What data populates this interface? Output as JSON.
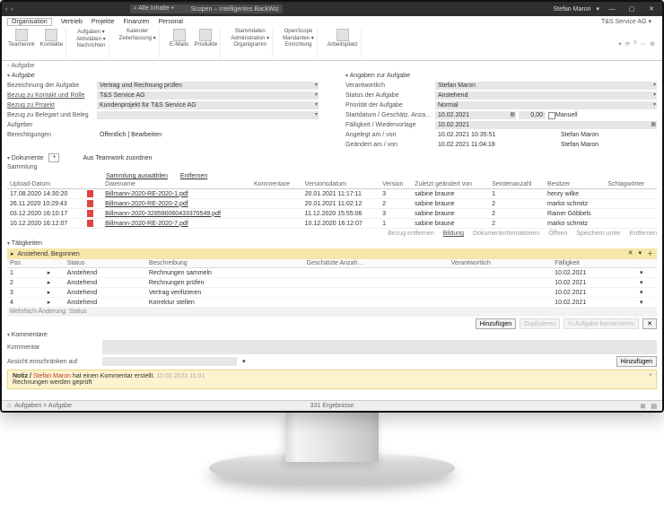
{
  "title": {
    "user": "Stefan Maron",
    "app": "Scopen – Intelligentes BackWiz",
    "search_scope": "Alle Inhalte"
  },
  "company": "T&S Service AG",
  "menu": [
    "Organisation",
    "Vertrieb",
    "Projekte",
    "Finanzen",
    "Personal"
  ],
  "ribbon": {
    "big": [
      {
        "name": "teamwork",
        "label": "Teamwork"
      },
      {
        "name": "kontakte",
        "label": "Kontakte"
      }
    ],
    "sub1": [
      "Aufgaben ▾",
      "Aktivitäten ▾",
      "Nachrichten"
    ],
    "sub2": [
      "Kalender",
      "Zeiterfassung ▾"
    ],
    "big2": [
      {
        "name": "emails",
        "label": "E-Mails"
      },
      {
        "name": "produkte",
        "label": "Produkte"
      }
    ],
    "sub3": [
      "Stammdaten",
      "Administration ▾",
      "Organigramm"
    ],
    "sub4": [
      "OpenScope",
      "Mandanten ▾",
      "Einrichtung"
    ],
    "arbeitsplatz": "Arbeitsplatz"
  },
  "crumb": "Aufgabe",
  "left": {
    "section": "Aufgabe",
    "rows": [
      {
        "label": "Bezeichnung der Aufgabe",
        "value": "Vertrag und Rechnung prüfen",
        "dd": true
      },
      {
        "label": "Bezug zu Kontakt und Rolle",
        "value": "T&S Service AG",
        "dd": true,
        "u": true
      },
      {
        "label": "Bezug zu Projekt",
        "value": "Kundenprojekt für T&S Service AG",
        "dd": true,
        "u": true
      },
      {
        "label": "Bezug zu Belegart und Beleg",
        "value": "",
        "dd": true
      },
      {
        "label": "Aufgeber",
        "value": "",
        "plain": true
      },
      {
        "label": "Berechtigungen",
        "value": "Öffentlich | Bearbeiten",
        "plain": true
      }
    ]
  },
  "right": {
    "section": "Angaben zur Aufgabe",
    "rows": [
      {
        "label": "Verantwortlich",
        "value": "Stefan Maron",
        "dd": true
      },
      {
        "label": "Status der Aufgabe",
        "value": "Anstehend",
        "dd": true
      },
      {
        "label": "Priorität der Aufgabe",
        "value": "Normal",
        "dd": true
      },
      {
        "label": "Startdatum / Geschätz. Anza…",
        "value": "10.02.2021",
        "cal": true,
        "extra_num": "0,00",
        "extra_label": "Manuell",
        "extra_chk": true
      },
      {
        "label": "Fälligkeit / Wiedervorlage",
        "value": "10.02.2021",
        "cal": true
      },
      {
        "label": "Angelegt am / von",
        "value": "10.02.2021 10:35:51",
        "person": "Stefan Maron"
      },
      {
        "label": "Geändert am / von",
        "value": "10.02.2021 11:04:18",
        "person": "Stefan Maron"
      }
    ]
  },
  "docs": {
    "section": "Dokumente",
    "assign": "Aus Teamwork zuordnen",
    "collection_label": "Sammlung",
    "tools": [
      "Sammlung auswählen",
      "Entfernen"
    ],
    "cols": [
      "Upload-Datum",
      "",
      "Dateiname",
      "Kommentare",
      "Versionsdatum",
      "Version",
      "Zuletzt geändert von",
      "Seintenanzahl",
      "Besitzer",
      "Schlagwörter"
    ],
    "rows": [
      {
        "date": "17.08.2020 14:30:20",
        "file": "Billmann-2020-RE-2020-1.pdf",
        "vdate": "20.01.2021 11:17:11",
        "ver": "3",
        "by": "sabine braune",
        "pages": "1",
        "owner": "henry wilke"
      },
      {
        "date": "26.11.2020 10:29:43",
        "file": "Billmann-2020-RE-2020-2.pdf",
        "vdate": "20.01.2021 11:02:12",
        "ver": "2",
        "by": "sabine braune",
        "pages": "2",
        "owner": "marko schmitz"
      },
      {
        "date": "03.12.2020 16:10:17",
        "file": "Billmann-2020-328590060433370549.pdf",
        "vdate": "11.12.2020 15:55:06",
        "ver": "3",
        "by": "sabine braune",
        "pages": "2",
        "owner": "Rainer Göbbels"
      },
      {
        "date": "10.12.2020 16:12:07",
        "file": "Billmann-2020-RE-2020-7.pdf",
        "vdate": "10.12.2020 16:12:07",
        "ver": "1",
        "by": "sabine braune",
        "pages": "2",
        "owner": "marko schmitz"
      }
    ],
    "footer": [
      "Bezug entfernen",
      "Bildung",
      "Dokumentinformationen",
      "Öffnen",
      "Speichern unter",
      "Entfernen"
    ]
  },
  "activities": {
    "section": "Tätigkeiten",
    "filter": "Anstehend, Begonnen",
    "cols": [
      "Pos",
      "",
      "Status",
      "Beschreibung",
      "Geschätzte Anzah…",
      "Verantwortlich",
      "Fälligkeit",
      ""
    ],
    "rows": [
      {
        "pos": "1",
        "status": "Anstehend",
        "desc": "Rechnungen sammeln",
        "due": "10.02.2021"
      },
      {
        "pos": "2",
        "status": "Anstehend",
        "desc": "Rechnungen prüfen",
        "due": "10.02.2021"
      },
      {
        "pos": "3",
        "status": "Anstehend",
        "desc": "Vertrag verifizieren",
        "due": "10.02.2021"
      },
      {
        "pos": "4",
        "status": "Anstehend",
        "desc": "Korrektur stellen",
        "due": "10.02.2021"
      }
    ],
    "total_label": "Mehrfach-Änderung: Status",
    "buttons": [
      "Hinzufügen",
      "Duplizieren",
      "In Aufgabe konvertieren",
      "✕"
    ]
  },
  "comments": {
    "section": "Kommentare",
    "label": "Kommentar",
    "restrict_label": "Ansicht einschränken auf",
    "add": "Hinzufügen"
  },
  "note": {
    "prefix": "Notiz /",
    "who": "Stefan Maron",
    "action": "hat einen Kommentar erstellt.",
    "ts": "10.02.2021 11:01",
    "body": "Rechnungen werden geprüft"
  },
  "status": {
    "path": "Aufgaben > Aufgabe",
    "count": "331 Ergebnisse"
  }
}
